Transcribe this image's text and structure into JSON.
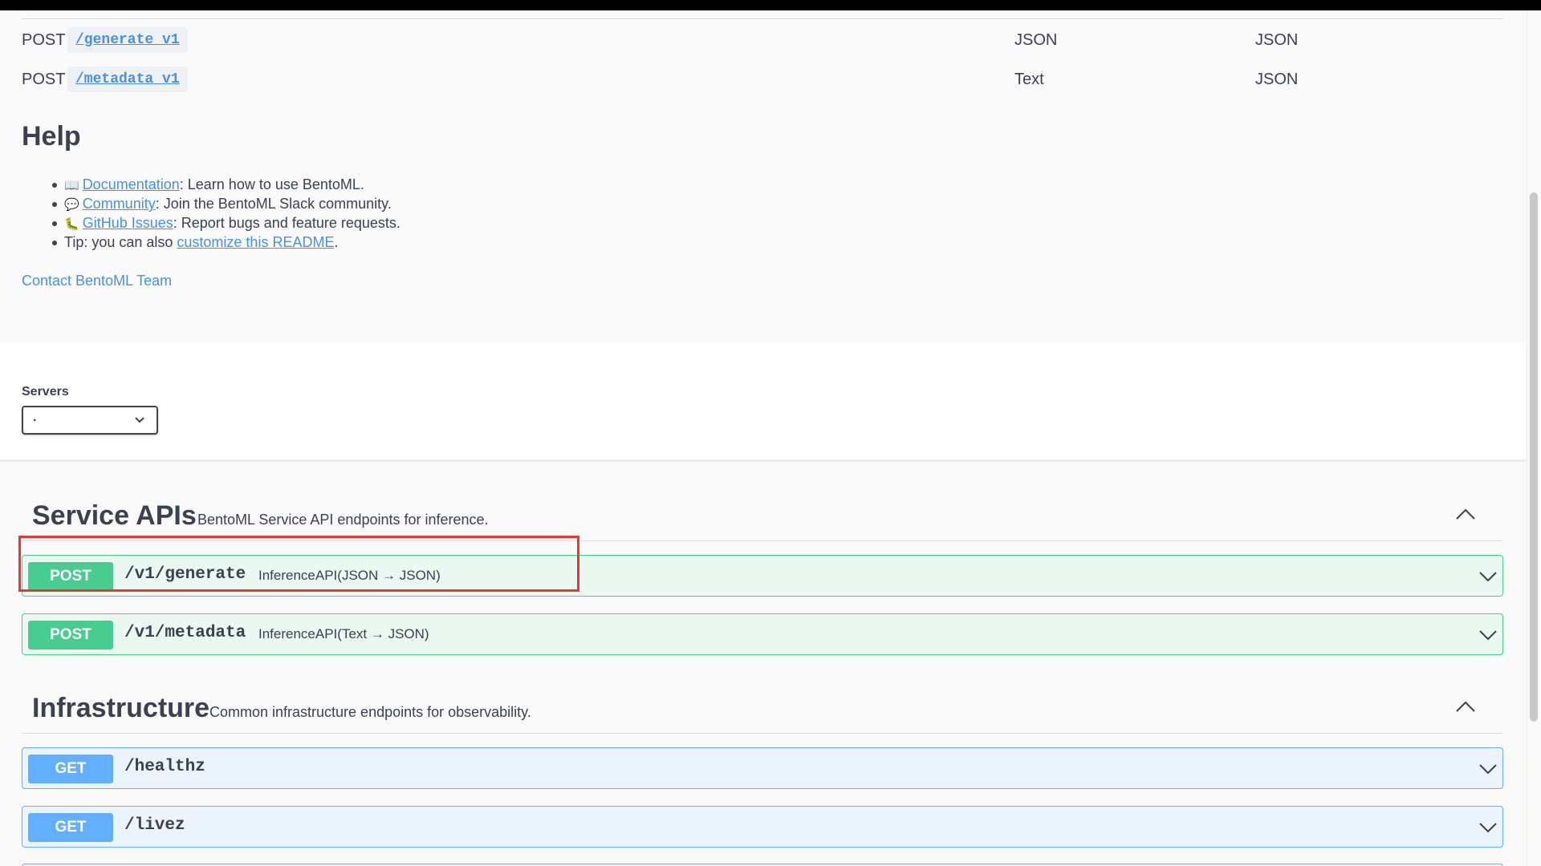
{
  "endpoints_table": [
    {
      "method": "POST",
      "path": "/generate_v1",
      "input": "JSON",
      "output": "JSON"
    },
    {
      "method": "POST",
      "path": "/metadata_v1",
      "input": "Text",
      "output": "JSON"
    }
  ],
  "help": {
    "title": "Help",
    "items": [
      {
        "icon": "📖",
        "link": "Documentation",
        "text": ": Learn how to use BentoML."
      },
      {
        "icon": "💬",
        "link": "Community",
        "text": ": Join the BentoML Slack community."
      },
      {
        "icon": "🐛",
        "link": "GitHub Issues",
        "text": ": Report bugs and feature requests."
      }
    ],
    "tip_prefix": "Tip: you can also ",
    "tip_link": "customize this README",
    "tip_suffix": ".",
    "contact": "Contact BentoML Team"
  },
  "servers": {
    "label": "Servers",
    "selected": "."
  },
  "service_apis": {
    "title": "Service APIs",
    "description": "BentoML Service API endpoints for inference.",
    "operations": [
      {
        "method": "POST",
        "path": "/v1/generate",
        "summary": "InferenceAPI(JSON → JSON)"
      },
      {
        "method": "POST",
        "path": "/v1/metadata",
        "summary": "InferenceAPI(Text → JSON)"
      }
    ]
  },
  "infrastructure": {
    "title": "Infrastructure",
    "description": "Common infrastructure endpoints for observability.",
    "operations": [
      {
        "method": "GET",
        "path": "/healthz"
      },
      {
        "method": "GET",
        "path": "/livez"
      }
    ]
  },
  "colors": {
    "post": "#49cc90",
    "get": "#61affe",
    "link": "#4990e2",
    "highlight": "#e53935"
  }
}
